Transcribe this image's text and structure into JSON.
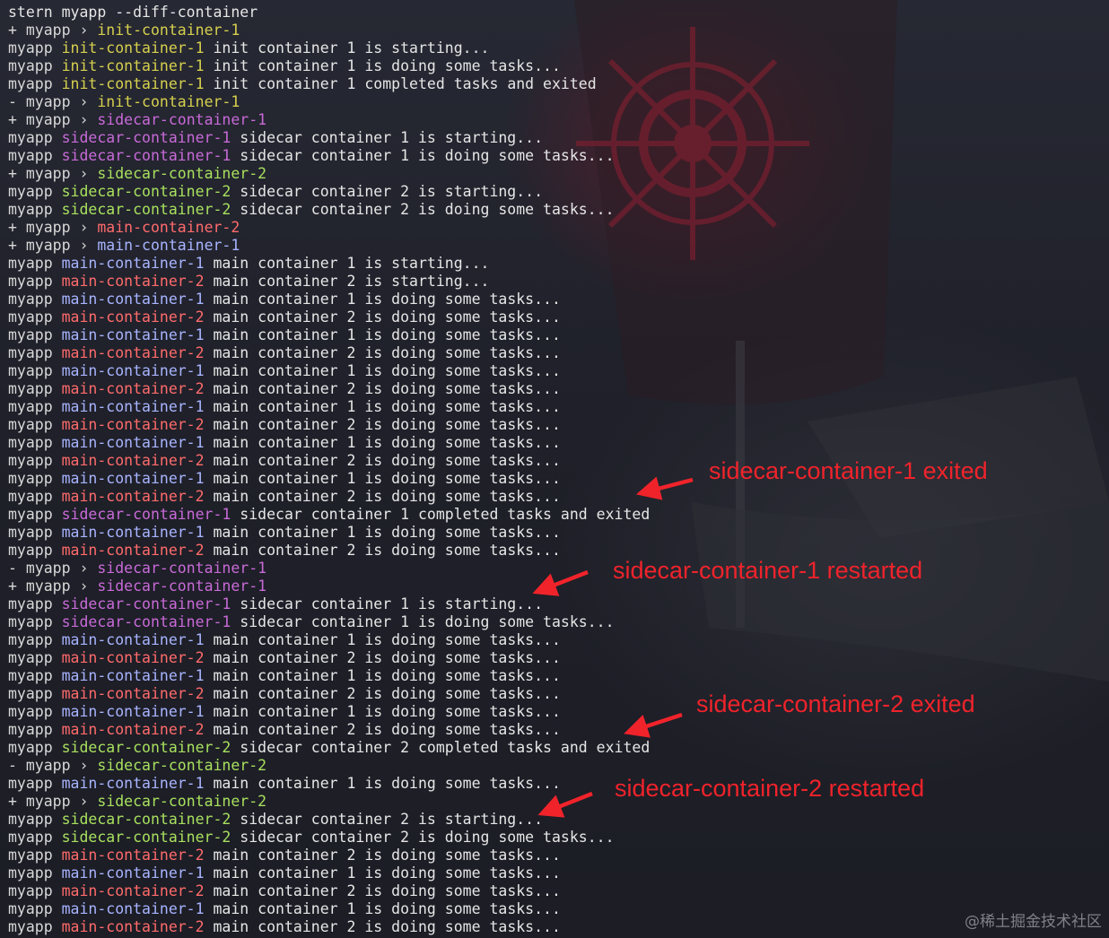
{
  "colors": {
    "default": "#e6e6e6",
    "init-container-1": "#d6d04e",
    "sidecar-container-1": "#c86ad8",
    "sidecar-container-2": "#a8e05e",
    "main-container-2": "#ff6b6b",
    "main-container-1": "#a8b4ff",
    "annotation": "#f0232b"
  },
  "terminal": {
    "lines": [
      {
        "type": "command",
        "text": "stern myapp --diff-container"
      },
      {
        "type": "event",
        "sign": "+",
        "pod": "myapp",
        "sep": "›",
        "container": "init-container-1",
        "color": "c-yellow"
      },
      {
        "type": "log",
        "pod": "myapp",
        "container": "init-container-1",
        "message": "init container 1 is starting...",
        "color": "c-yellow"
      },
      {
        "type": "log",
        "pod": "myapp",
        "container": "init-container-1",
        "message": "init container 1 is doing some tasks...",
        "color": "c-yellow"
      },
      {
        "type": "log",
        "pod": "myapp",
        "container": "init-container-1",
        "message": "init container 1 completed tasks and exited",
        "color": "c-yellow"
      },
      {
        "type": "event",
        "sign": "-",
        "pod": "myapp",
        "sep": "›",
        "container": "init-container-1",
        "color": "c-yellow"
      },
      {
        "type": "event",
        "sign": "+",
        "pod": "myapp",
        "sep": "›",
        "container": "sidecar-container-1",
        "color": "c-magenta"
      },
      {
        "type": "log",
        "pod": "myapp",
        "container": "sidecar-container-1",
        "message": "sidecar container 1 is starting...",
        "color": "c-magenta"
      },
      {
        "type": "log",
        "pod": "myapp",
        "container": "sidecar-container-1",
        "message": "sidecar container 1 is doing some tasks...",
        "color": "c-magenta"
      },
      {
        "type": "event",
        "sign": "+",
        "pod": "myapp",
        "sep": "›",
        "container": "sidecar-container-2",
        "color": "c-green"
      },
      {
        "type": "log",
        "pod": "myapp",
        "container": "sidecar-container-2",
        "message": "sidecar container 2 is starting...",
        "color": "c-green"
      },
      {
        "type": "log",
        "pod": "myapp",
        "container": "sidecar-container-2",
        "message": "sidecar container 2 is doing some tasks...",
        "color": "c-green"
      },
      {
        "type": "event",
        "sign": "+",
        "pod": "myapp",
        "sep": "›",
        "container": "main-container-2",
        "color": "c-red"
      },
      {
        "type": "event",
        "sign": "+",
        "pod": "myapp",
        "sep": "›",
        "container": "main-container-1",
        "color": "c-blue"
      },
      {
        "type": "log",
        "pod": "myapp",
        "container": "main-container-1",
        "message": "main container 1 is starting...",
        "color": "c-blue"
      },
      {
        "type": "log",
        "pod": "myapp",
        "container": "main-container-2",
        "message": "main container 2 is starting...",
        "color": "c-red"
      },
      {
        "type": "log",
        "pod": "myapp",
        "container": "main-container-1",
        "message": "main container 1 is doing some tasks...",
        "color": "c-blue"
      },
      {
        "type": "log",
        "pod": "myapp",
        "container": "main-container-2",
        "message": "main container 2 is doing some tasks...",
        "color": "c-red"
      },
      {
        "type": "log",
        "pod": "myapp",
        "container": "main-container-1",
        "message": "main container 1 is doing some tasks...",
        "color": "c-blue"
      },
      {
        "type": "log",
        "pod": "myapp",
        "container": "main-container-2",
        "message": "main container 2 is doing some tasks...",
        "color": "c-red"
      },
      {
        "type": "log",
        "pod": "myapp",
        "container": "main-container-1",
        "message": "main container 1 is doing some tasks...",
        "color": "c-blue"
      },
      {
        "type": "log",
        "pod": "myapp",
        "container": "main-container-2",
        "message": "main container 2 is doing some tasks...",
        "color": "c-red"
      },
      {
        "type": "log",
        "pod": "myapp",
        "container": "main-container-1",
        "message": "main container 1 is doing some tasks...",
        "color": "c-blue"
      },
      {
        "type": "log",
        "pod": "myapp",
        "container": "main-container-2",
        "message": "main container 2 is doing some tasks...",
        "color": "c-red"
      },
      {
        "type": "log",
        "pod": "myapp",
        "container": "main-container-1",
        "message": "main container 1 is doing some tasks...",
        "color": "c-blue"
      },
      {
        "type": "log",
        "pod": "myapp",
        "container": "main-container-2",
        "message": "main container 2 is doing some tasks...",
        "color": "c-red"
      },
      {
        "type": "log",
        "pod": "myapp",
        "container": "main-container-1",
        "message": "main container 1 is doing some tasks...",
        "color": "c-blue"
      },
      {
        "type": "log",
        "pod": "myapp",
        "container": "main-container-2",
        "message": "main container 2 is doing some tasks...",
        "color": "c-red"
      },
      {
        "type": "log",
        "pod": "myapp",
        "container": "sidecar-container-1",
        "message": "sidecar container 1 completed tasks and exited",
        "color": "c-magenta"
      },
      {
        "type": "log",
        "pod": "myapp",
        "container": "main-container-1",
        "message": "main container 1 is doing some tasks...",
        "color": "c-blue"
      },
      {
        "type": "log",
        "pod": "myapp",
        "container": "main-container-2",
        "message": "main container 2 is doing some tasks...",
        "color": "c-red"
      },
      {
        "type": "event",
        "sign": "-",
        "pod": "myapp",
        "sep": "›",
        "container": "sidecar-container-1",
        "color": "c-magenta"
      },
      {
        "type": "event",
        "sign": "+",
        "pod": "myapp",
        "sep": "›",
        "container": "sidecar-container-1",
        "color": "c-magenta"
      },
      {
        "type": "log",
        "pod": "myapp",
        "container": "sidecar-container-1",
        "message": "sidecar container 1 is starting...",
        "color": "c-magenta"
      },
      {
        "type": "log",
        "pod": "myapp",
        "container": "sidecar-container-1",
        "message": "sidecar container 1 is doing some tasks...",
        "color": "c-magenta"
      },
      {
        "type": "log",
        "pod": "myapp",
        "container": "main-container-1",
        "message": "main container 1 is doing some tasks...",
        "color": "c-blue"
      },
      {
        "type": "log",
        "pod": "myapp",
        "container": "main-container-2",
        "message": "main container 2 is doing some tasks...",
        "color": "c-red"
      },
      {
        "type": "log",
        "pod": "myapp",
        "container": "main-container-1",
        "message": "main container 1 is doing some tasks...",
        "color": "c-blue"
      },
      {
        "type": "log",
        "pod": "myapp",
        "container": "main-container-2",
        "message": "main container 2 is doing some tasks...",
        "color": "c-red"
      },
      {
        "type": "log",
        "pod": "myapp",
        "container": "main-container-1",
        "message": "main container 1 is doing some tasks...",
        "color": "c-blue"
      },
      {
        "type": "log",
        "pod": "myapp",
        "container": "main-container-2",
        "message": "main container 2 is doing some tasks...",
        "color": "c-red"
      },
      {
        "type": "log",
        "pod": "myapp",
        "container": "sidecar-container-2",
        "message": "sidecar container 2 completed tasks and exited",
        "color": "c-green"
      },
      {
        "type": "event",
        "sign": "-",
        "pod": "myapp",
        "sep": "›",
        "container": "sidecar-container-2",
        "color": "c-green"
      },
      {
        "type": "log",
        "pod": "myapp",
        "container": "main-container-1",
        "message": "main container 1 is doing some tasks...",
        "color": "c-blue"
      },
      {
        "type": "event",
        "sign": "+",
        "pod": "myapp",
        "sep": "›",
        "container": "sidecar-container-2",
        "color": "c-green"
      },
      {
        "type": "log",
        "pod": "myapp",
        "container": "sidecar-container-2",
        "message": "sidecar container 2 is starting...",
        "color": "c-green"
      },
      {
        "type": "log",
        "pod": "myapp",
        "container": "sidecar-container-2",
        "message": "sidecar container 2 is doing some tasks...",
        "color": "c-green"
      },
      {
        "type": "log",
        "pod": "myapp",
        "container": "main-container-2",
        "message": "main container 2 is doing some tasks...",
        "color": "c-red"
      },
      {
        "type": "log",
        "pod": "myapp",
        "container": "main-container-1",
        "message": "main container 1 is doing some tasks...",
        "color": "c-blue"
      },
      {
        "type": "log",
        "pod": "myapp",
        "container": "main-container-2",
        "message": "main container 2 is doing some tasks...",
        "color": "c-red"
      },
      {
        "type": "log",
        "pod": "myapp",
        "container": "main-container-1",
        "message": "main container 1 is doing some tasks...",
        "color": "c-blue"
      },
      {
        "type": "log",
        "pod": "myapp",
        "container": "main-container-2",
        "message": "main container 2 is doing some tasks...",
        "color": "c-red"
      }
    ]
  },
  "annotations": {
    "sidecar1_exited": "sidecar-container-1 exited",
    "sidecar1_restarted": "sidecar-container-1 restarted",
    "sidecar2_exited": "sidecar-container-2 exited",
    "sidecar2_restarted": "sidecar-container-2 restarted"
  },
  "watermark": {
    "text": "@稀土掘金技术社区"
  }
}
